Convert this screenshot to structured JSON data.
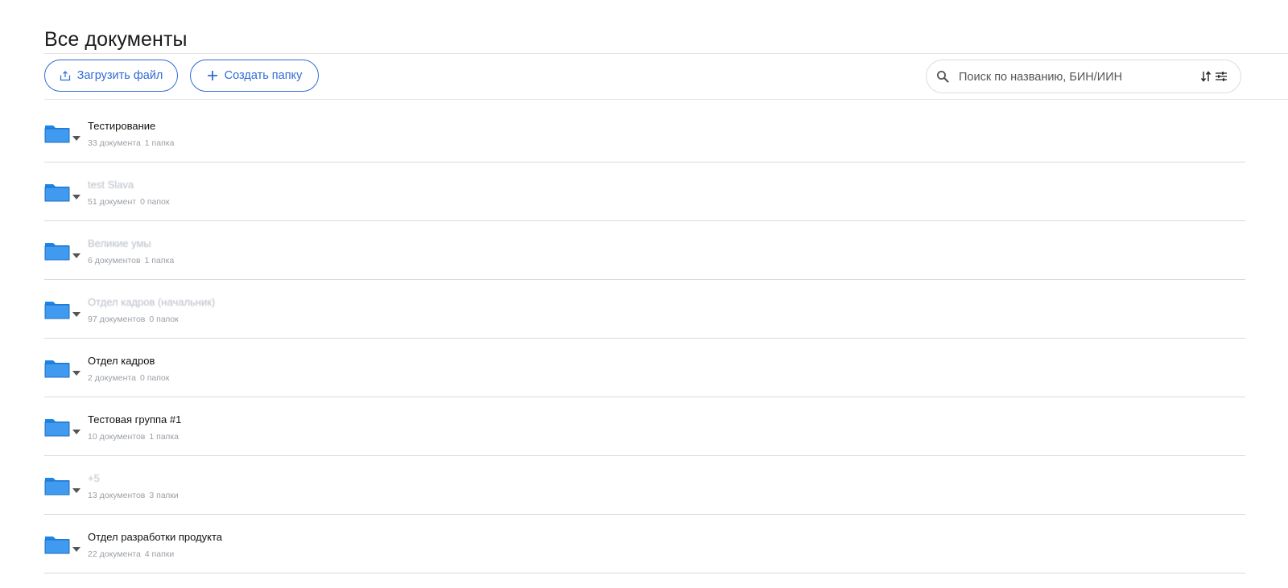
{
  "header": {
    "title": "Все документы"
  },
  "toolbar": {
    "upload_label": "Загрузить файл",
    "create_label": "Создать папку",
    "search_placeholder": "Поиск по названию, БИН/ИИН"
  },
  "colors": {
    "accent": "#2f6bd6",
    "folder": "#1c85e8",
    "muted_text": "#9aa0a8",
    "divider": "#dadada"
  },
  "folders": [
    {
      "name": "Тестирование",
      "docs": "33 документа",
      "folders": "1 папка",
      "blurred": false
    },
    {
      "name": "test Slava",
      "docs": "51 документ",
      "folders": "0 папок",
      "blurred": true
    },
    {
      "name": "Великие умы",
      "docs": "6 документов",
      "folders": "1 папка",
      "blurred": true
    },
    {
      "name": "Отдел кадров (начальник)",
      "docs": "97 документов",
      "folders": "0 папок",
      "blurred": true
    },
    {
      "name": "Отдел кадров",
      "docs": "2 документа",
      "folders": "0 папок",
      "blurred": false
    },
    {
      "name": "Тестовая группа #1",
      "docs": "10 документов",
      "folders": "1 папка",
      "blurred": false
    },
    {
      "name": "+5",
      "docs": "13 документов",
      "folders": "3 папки",
      "blurred": true
    },
    {
      "name": "Отдел разработки продукта",
      "docs": "22 документа",
      "folders": "4 папки",
      "blurred": false
    }
  ]
}
